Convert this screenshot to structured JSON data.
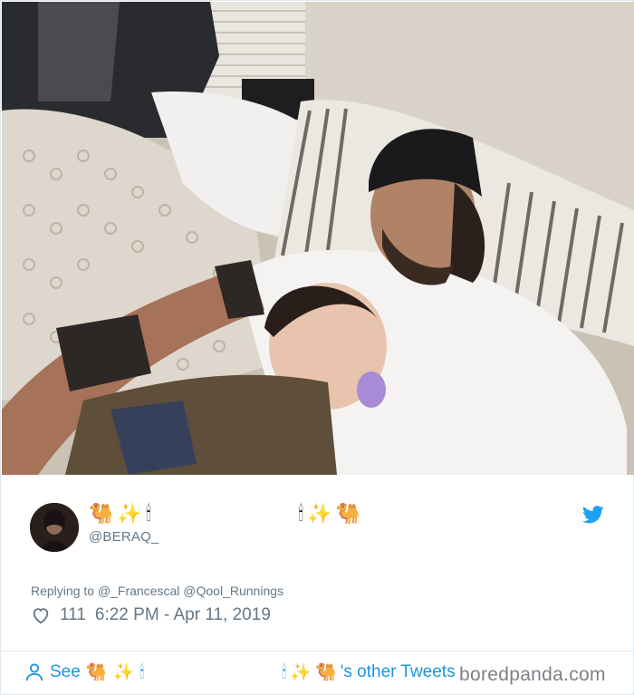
{
  "tweet": {
    "display_name_left_emojis": [
      "🐫",
      "✨",
      "🕯"
    ],
    "display_name_right_emojis": [
      "🕯",
      "✨",
      "🐫"
    ],
    "handle": "@BERAQ_",
    "replying_prefix": "Replying to",
    "replying_to": "@_Francescal @Qool_Runnings",
    "like_count": "111",
    "timestamp": "6:22 PM - Apr 11, 2019"
  },
  "footer": {
    "see_label": "See",
    "see_emojis": [
      "🐫",
      "✨",
      "🕯"
    ],
    "other_emojis": [
      "🕯",
      "✨",
      "🐫"
    ],
    "other_tweets_label": "'s other Tweets"
  },
  "watermark": "boredpanda.com",
  "icons": {
    "bird": "twitter-bird-icon",
    "heart": "heart-icon",
    "person": "person-icon"
  },
  "colors": {
    "twitter_blue": "#1da1f2",
    "link_blue": "#1b95e0",
    "muted": "#657786"
  }
}
